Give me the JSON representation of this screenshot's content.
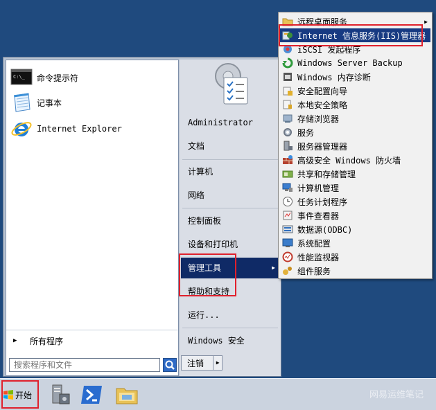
{
  "start_menu": {
    "pinned": [
      {
        "label": "命令提示符",
        "icon": "cmd-icon"
      },
      {
        "label": "记事本",
        "icon": "notepad-icon"
      },
      {
        "label": "Internet Explorer",
        "icon": "ie-icon"
      }
    ],
    "all_programs": "所有程序",
    "search_placeholder": "搜索程序和文件",
    "right_items": [
      "Administrator",
      "文档",
      "计算机",
      "网络",
      "控制面板",
      "设备和打印机",
      "管理工具",
      "帮助和支持",
      "运行...",
      "Windows 安全"
    ],
    "active_item": "管理工具",
    "logoff_label": "注销"
  },
  "admin_tools": {
    "items": [
      "远程桌面服务",
      "Internet 信息服务(IIS)管理器",
      "iSCSI 发起程序",
      "Windows Server Backup",
      "Windows 内存诊断",
      "安全配置向导",
      "本地安全策略",
      "存储浏览器",
      "服务",
      "服务器管理器",
      "高级安全 Windows 防火墙",
      "共享和存储管理",
      "计算机管理",
      "任务计划程序",
      "事件查看器",
      "数据源(ODBC)",
      "系统配置",
      "性能监视器",
      "组件服务"
    ],
    "selected": "Internet 信息服务(IIS)管理器"
  },
  "taskbar": {
    "start_label": "开始",
    "pinned": [
      "server-manager-icon",
      "powershell-icon",
      "explorer-icon"
    ],
    "watermark": "网易运维笔记"
  },
  "colors": {
    "desktop": "#1f4a7e",
    "highlight_navy": "#0f2a66",
    "annotation_red": "#e0202c"
  }
}
